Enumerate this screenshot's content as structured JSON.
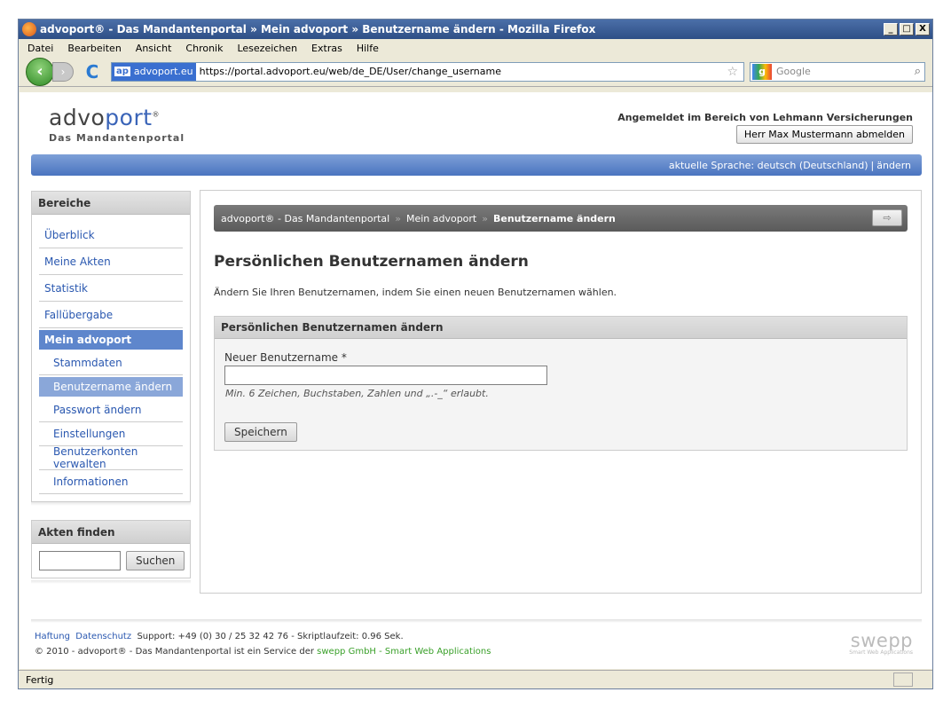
{
  "window": {
    "title": "advoport® - Das Mandantenportal  »  Mein advoport  »  Benutzername ändern - Mozilla Firefox",
    "min": "_",
    "max": "□",
    "close": "X"
  },
  "menu": [
    "Datei",
    "Bearbeiten",
    "Ansicht",
    "Chronik",
    "Lesezeichen",
    "Extras",
    "Hilfe"
  ],
  "toolbar": {
    "back_glyph": "‹",
    "forward_glyph": "›",
    "reload_glyph": "C",
    "site_badge": "ap",
    "site_identity": "advoport.eu",
    "url": "https://portal.advoport.eu/web/de_DE/User/change_username",
    "search_engine_glyph": "g",
    "search_placeholder": "Google"
  },
  "header": {
    "logo_advo": "advo",
    "logo_port": "port",
    "logo_reg": "®",
    "logo_sub": "Das Mandantenportal",
    "logged_in_text": "Angemeldet im Bereich von Lehmann Versicherungen",
    "logout_button": "Herr Max Mustermann abmelden"
  },
  "langbar": {
    "current": "aktuelle Sprache: deutsch (Deutschland)",
    "separator": "|",
    "change": "ändern"
  },
  "sidebar": {
    "heading": "Bereiche",
    "items": [
      {
        "label": "Überblick"
      },
      {
        "label": "Meine Akten"
      },
      {
        "label": "Statistik"
      },
      {
        "label": "Fallübergabe"
      },
      {
        "label": "Mein advoport"
      }
    ],
    "subitems": [
      {
        "label": "Stammdaten"
      },
      {
        "label": "Benutzername ändern"
      },
      {
        "label": "Passwort ändern"
      },
      {
        "label": "Einstellungen"
      },
      {
        "label": "Benutzerkonten verwalten"
      },
      {
        "label": "Informationen"
      }
    ]
  },
  "search_box": {
    "heading": "Akten finden",
    "value": "",
    "button": "Suchen"
  },
  "breadcrumb": {
    "items": [
      "advoport® - Das Mandantenportal",
      "Mein advoport",
      "Benutzername ändern"
    ],
    "separator": "»",
    "print_glyph": "⇨"
  },
  "main": {
    "title": "Persönlichen Benutzernamen ändern",
    "intro": "Ändern Sie Ihren Benutzernamen, indem Sie einen neuen Benutzernamen wählen.",
    "form_heading": "Persönlichen Benutzernamen ändern",
    "field_label": "Neuer Benutzername *",
    "field_value": "",
    "hint": "Min. 6 Zeichen, Buchstaben, Zahlen und „.-_“ erlaubt.",
    "save_button": "Speichern"
  },
  "footer": {
    "haftung": "Haftung",
    "datenschutz": "Datenschutz",
    "support": "Support: +49 (0) 30 / 25 32 42 76 - Skriptlaufzeit: 0.96 Sek.",
    "copyright": "© 2010 - advoport® - Das Mandantenportal ist ein Service der",
    "company": "swepp GmbH - Smart Web Applications",
    "swepp_logo": "swepp",
    "swepp_sub": "Smart Web Applications"
  },
  "status": {
    "text": "Fertig"
  },
  "colors": {
    "accent": "#4a74c0",
    "link": "#2a58b0",
    "company_link": "#3aa02a"
  }
}
